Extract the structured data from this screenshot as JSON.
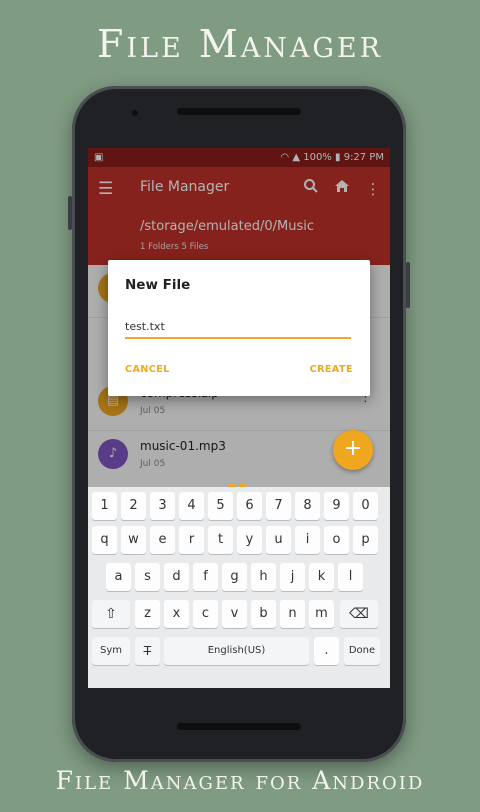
{
  "promo": {
    "title": "File Manager",
    "subtitle": "File Manager for Android"
  },
  "status_bar": {
    "left_icon": "image-notification-icon",
    "battery": "100%",
    "time": "9:27 PM"
  },
  "toolbar": {
    "title": "File Manager",
    "icons": [
      "menu-icon",
      "search-icon",
      "home-icon",
      "more-vert-icon"
    ]
  },
  "path_bar": {
    "path": "/storage/emulated/0/Music",
    "counts": "1 Folders 5 Files"
  },
  "files": [
    {
      "name": "compress.zip",
      "date": "Jul 05",
      "icon": "archive-icon",
      "color": "#f0a720"
    },
    {
      "name": "music-01.mp3",
      "date": "Jul 05",
      "icon": "music-note-icon",
      "color": "#7e57c2"
    }
  ],
  "dialog": {
    "title": "New File",
    "input_value": "test.txt",
    "cancel_label": "CANCEL",
    "create_label": "CREATE"
  },
  "fab": {
    "label": "+"
  },
  "keyboard": {
    "numbers": [
      "1",
      "2",
      "3",
      "4",
      "5",
      "6",
      "7",
      "8",
      "9",
      "0"
    ],
    "row1": [
      "q",
      "w",
      "e",
      "r",
      "t",
      "y",
      "u",
      "i",
      "o",
      "p"
    ],
    "row2": [
      "a",
      "s",
      "d",
      "f",
      "g",
      "h",
      "j",
      "k",
      "l"
    ],
    "row3": [
      "z",
      "x",
      "c",
      "v",
      "b",
      "n",
      "m"
    ],
    "shift": "⇧",
    "backspace": "⌫",
    "sym": "Sym",
    "handwriting": "T̶",
    "space": "English(US)",
    "period": ".",
    "done": "Done"
  },
  "colors": {
    "background": "#7f9b82",
    "primary": "#c0312a",
    "primary_dark": "#8c1f1a",
    "accent": "#f0a720"
  }
}
